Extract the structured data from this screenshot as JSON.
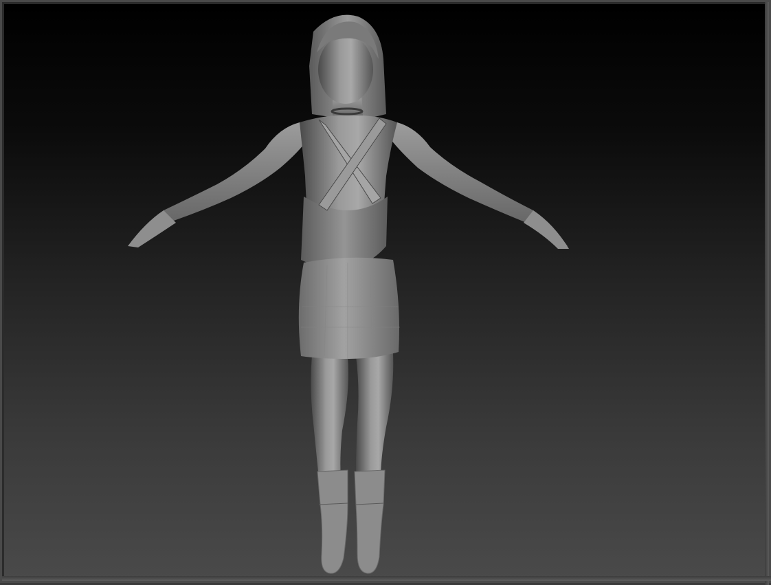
{
  "canvas": {
    "background_top": "#000000",
    "background_bottom": "#4a4a4a",
    "frame_color": "#4a4a4a"
  },
  "model": {
    "type": "female-sculpt-t-pose",
    "material": "matcap-gray",
    "base_color": "#8a8a8a",
    "highlight_color": "#bdbdbd",
    "shadow_color": "#3c3c3c"
  }
}
